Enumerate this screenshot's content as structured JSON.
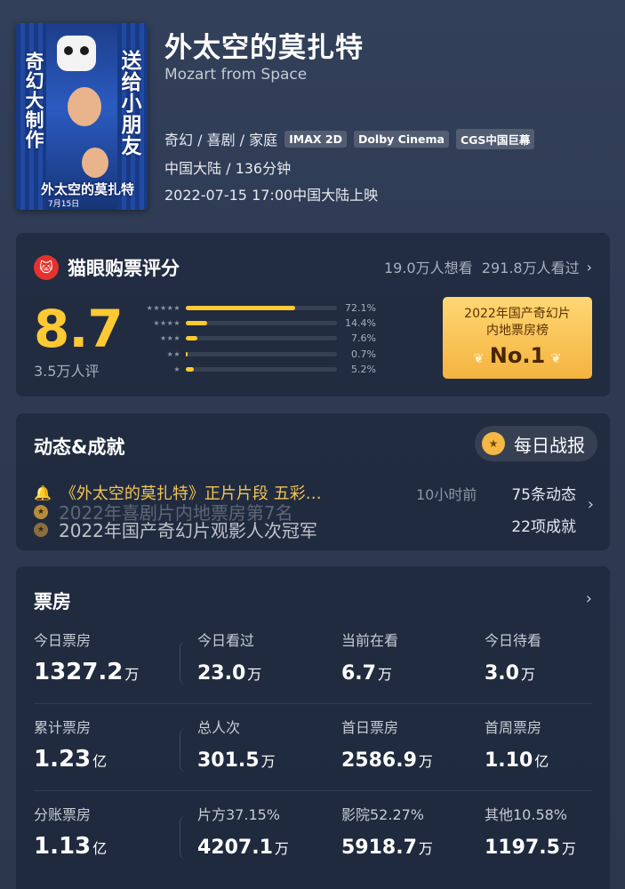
{
  "movie": {
    "poster": {
      "left_text": "奇幻大制作",
      "right_text": "送给小朋友",
      "title": "外太空的莫扎特",
      "date": "7月15日"
    },
    "title": "外太空的莫扎特",
    "title_en": "Mozart from Space",
    "genre": "奇幻 / 喜剧 / 家庭",
    "tags": [
      "IMAX 2D",
      "Dolby Cinema",
      "CGS中国巨幕"
    ],
    "region_duration": "中国大陆 / 136分钟",
    "release": "2022-07-15 17:00中国大陆上映"
  },
  "rating": {
    "title": "猫眼购票评分",
    "stats": "19.0万人想看  291.8万人看过",
    "score": "8.7",
    "count": "3.5万人评",
    "distribution": [
      {
        "stars": "★★★★★",
        "pct_label": "72.1%",
        "value": 72.1
      },
      {
        "stars": "★★★★",
        "pct_label": "14.4%",
        "value": 14.4
      },
      {
        "stars": "★★★",
        "pct_label": "7.6%",
        "value": 7.6
      },
      {
        "stars": "★★",
        "pct_label": "0.7%",
        "value": 0.7
      },
      {
        "stars": "★",
        "pct_label": "5.2%",
        "value": 5.2
      }
    ],
    "rank_title": "2022年国产奇幻片内地票房榜",
    "rank_no": "No.1"
  },
  "news": {
    "title": "动态&成就",
    "daily_label": "每日战报",
    "headline": "《外太空的莫扎特》正片片段 五彩…",
    "time": "10小时前",
    "achievements": [
      "2022年喜剧片内地票房第7名",
      "2022年国产奇幻片观影人次冠军"
    ],
    "dynamics_count": "75条动态",
    "achievement_count": "22项成就"
  },
  "boxoffice": {
    "title": "票房",
    "rows": [
      [
        {
          "label": "今日票房",
          "value": "1327.2",
          "unit": "万"
        },
        {
          "label": "今日看过",
          "value": "23.0",
          "unit": "万"
        },
        {
          "label": "当前在看",
          "value": "6.7",
          "unit": "万"
        },
        {
          "label": "今日待看",
          "value": "3.0",
          "unit": "万"
        }
      ],
      [
        {
          "label": "累计票房",
          "value": "1.23",
          "unit": "亿"
        },
        {
          "label": "总人次",
          "value": "301.5",
          "unit": "万"
        },
        {
          "label": "首日票房",
          "value": "2586.9",
          "unit": "万"
        },
        {
          "label": "首周票房",
          "value": "1.10",
          "unit": "亿"
        }
      ],
      [
        {
          "label": "分账票房",
          "value": "1.13",
          "unit": "亿"
        },
        {
          "label": "片方37.15%",
          "value": "4207.1",
          "unit": "万"
        },
        {
          "label": "影院52.27%",
          "value": "5918.7",
          "unit": "万"
        },
        {
          "label": "其他10.58%",
          "value": "1197.5",
          "unit": "万"
        }
      ]
    ]
  }
}
